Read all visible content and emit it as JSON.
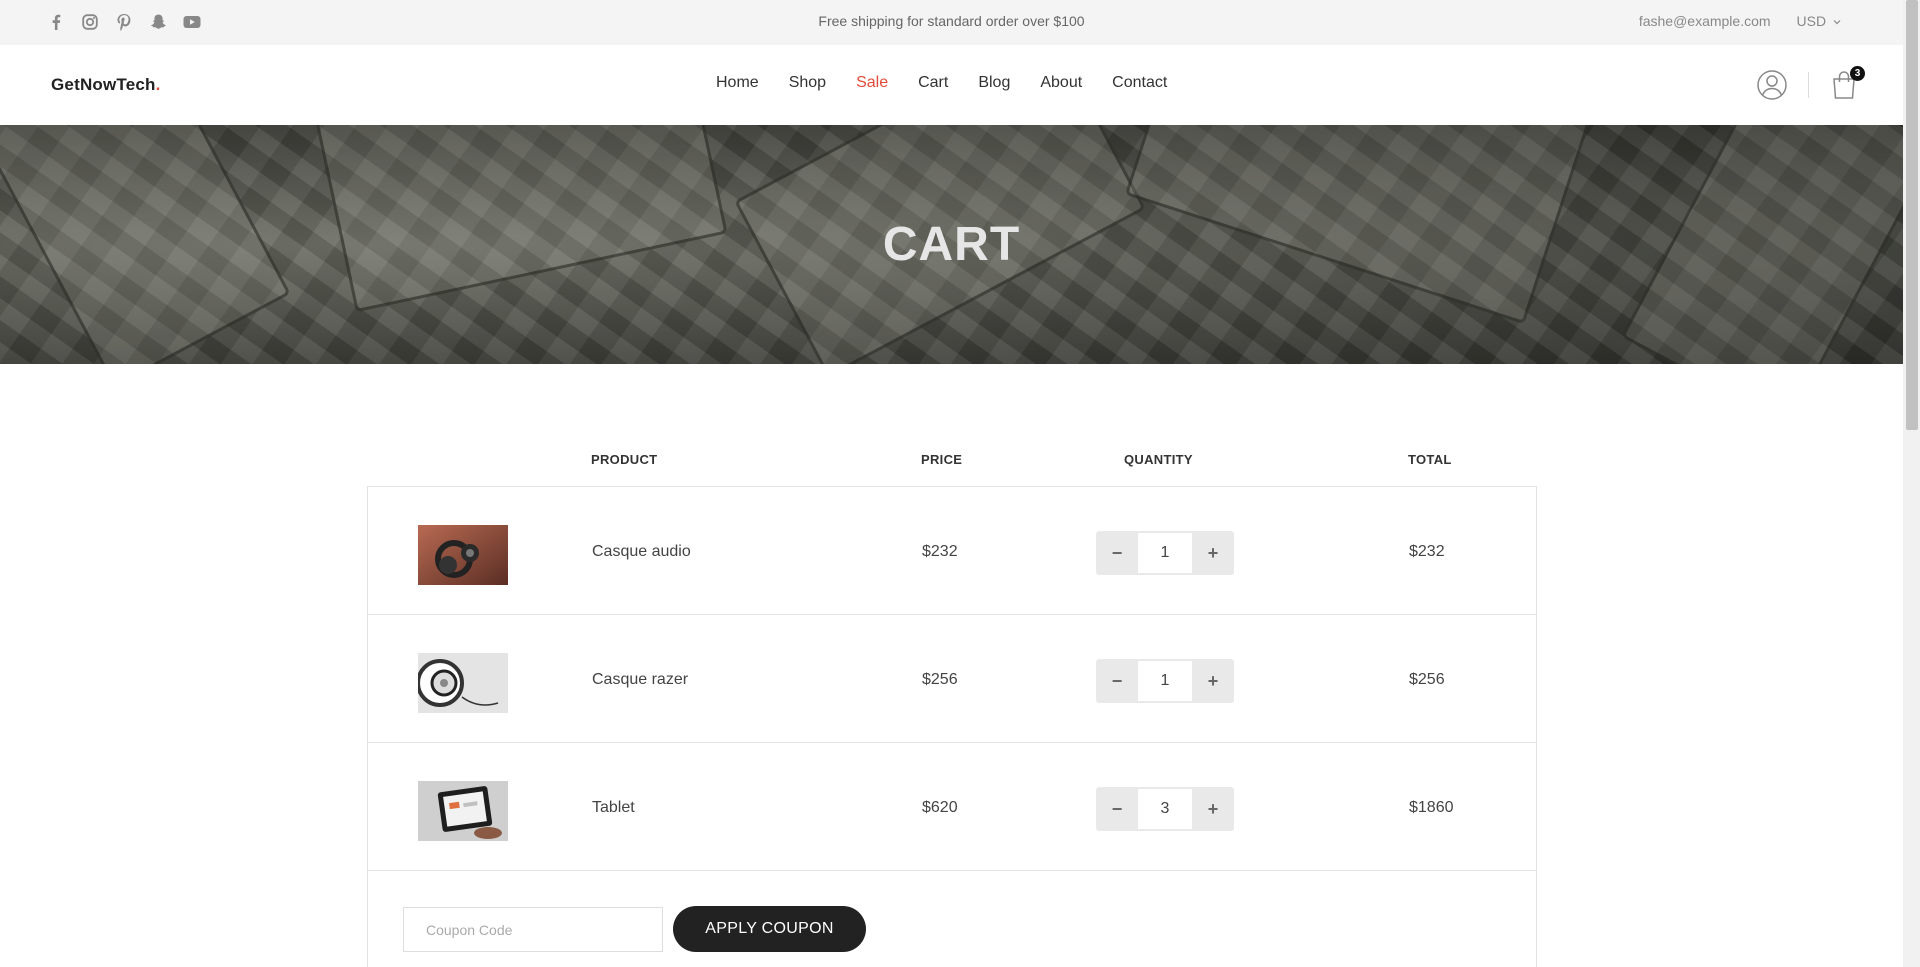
{
  "topbar": {
    "social_icons": [
      "facebook-icon",
      "instagram-icon",
      "pinterest-icon",
      "snapchat-icon",
      "youtube-icon"
    ],
    "shipping_text": "Free shipping for standard order over $100",
    "email": "fashe@example.com",
    "currency": "USD"
  },
  "header": {
    "logo_text": "GetNowTech",
    "logo_dot": ".",
    "nav": [
      "Home",
      "Shop",
      "Sale",
      "Cart",
      "Blog",
      "About",
      "Contact"
    ],
    "active_nav": "Sale",
    "cart_count": "3"
  },
  "hero": {
    "title": "CART"
  },
  "table": {
    "headers": {
      "product": "PRODUCT",
      "price": "PRICE",
      "quantity": "QUANTITY",
      "total": "TOTAL"
    },
    "rows": [
      {
        "name": "Casque audio",
        "price": "$232",
        "qty": "1",
        "total": "$232",
        "image": "headphones-photo"
      },
      {
        "name": "Casque razer",
        "price": "$256",
        "qty": "1",
        "total": "$256",
        "image": "white-headphones-photo"
      },
      {
        "name": "Tablet",
        "price": "$620",
        "qty": "3",
        "total": "$1860",
        "image": "tablet-photo"
      }
    ],
    "minus_label": "−",
    "plus_label": "+"
  },
  "coupon": {
    "placeholder": "Coupon Code",
    "apply_label": "APPLY COUPON"
  },
  "colors": {
    "accent": "#e24a3a",
    "dark_button": "#222222",
    "topbar_bg": "#f4f4f4"
  }
}
